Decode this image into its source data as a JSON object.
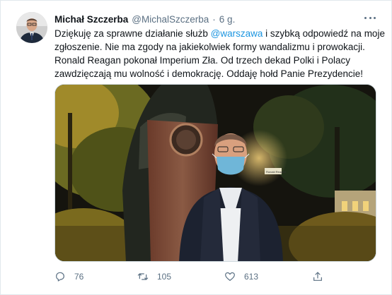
{
  "tweet": {
    "author_name": "Michał Szczerba",
    "author_handle": "@MichalSzczerba",
    "separator": "·",
    "time": "6 g.",
    "text_lines": [
      {
        "before": "Dziękuję za sprawne działanie służb ",
        "mention": "@warszawa",
        "after": " i szybką odpowiedź na moje"
      },
      {
        "text": "zgłoszenie. Nie ma zgody na jakiekolwiek formy wandalizmu i prowokacji."
      },
      {
        "text": "Ronald Reagan pokonał Imperium Zła. Od trzech dekad Polki i Polacy"
      },
      {
        "text": "zawdzięczają mu wolność i demokrację. Oddaję hołd Panie Prezydencie!"
      }
    ],
    "media_sign_text": "Ronald Reagan"
  },
  "actions": {
    "reply_count": "76",
    "retweet_count": "105",
    "like_count": "613"
  },
  "icons": {
    "reply": "reply-icon",
    "retweet": "retweet-icon",
    "like": "heart-icon",
    "share": "share-icon",
    "more": "more-icon"
  },
  "colors": {
    "text": "#0f1419",
    "secondary": "#5b7083",
    "link": "#1b95e0",
    "border": "#e1e8ed"
  }
}
